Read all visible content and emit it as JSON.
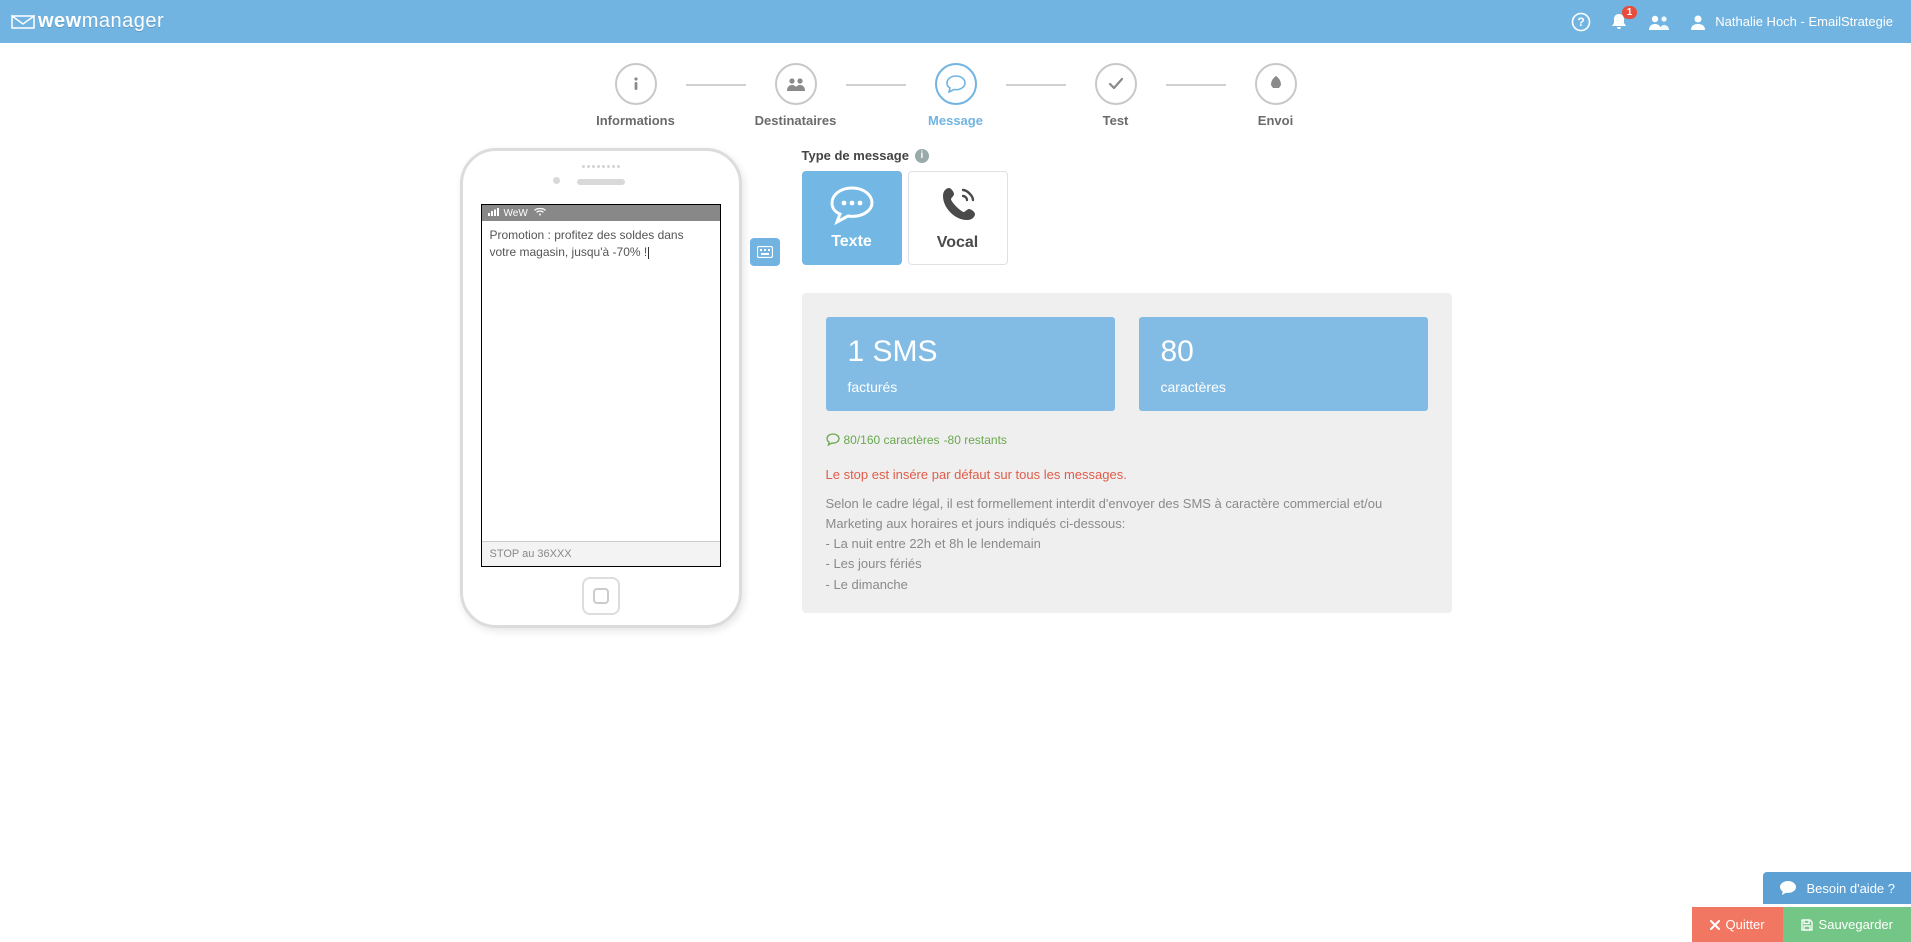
{
  "header": {
    "logo_text": "wewmanager",
    "notification_badge": "1",
    "user_name": "Nathalie Hoch - EmailStrategie"
  },
  "stepper": {
    "steps": [
      {
        "label": "Informations"
      },
      {
        "label": "Destinataires"
      },
      {
        "label": "Message"
      },
      {
        "label": "Test"
      },
      {
        "label": "Envoi"
      }
    ]
  },
  "phone": {
    "carrier": "WeW",
    "message_text": "Promotion : profitez des soldes dans votre magasin, jusqu'à -70% !",
    "stop_text": "STOP au 36XXX"
  },
  "panel": {
    "type_label": "Type de message",
    "type_texte": "Texte",
    "type_vocal": "Vocal",
    "stat_sms_value": "1 SMS",
    "stat_sms_label": "facturés",
    "stat_chars_value": "80",
    "stat_chars_label": "caractères",
    "char_counter_main": "80/160 caractères",
    "char_counter_remaining": "-80 restants",
    "warn_text": "Le stop est insére par défaut sur tous les messages.",
    "legal_intro": "Selon le cadre légal, il est formellement interdit d'envoyer des SMS à caractère commercial et/ou Marketing aux horaires et jours indiqués ci-dessous:",
    "legal_line1": "- La nuit entre 22h et 8h le lendemain",
    "legal_line2": "- Les jours fériés",
    "legal_line3": "- Le dimanche"
  },
  "help": {
    "label": "Besoin d'aide ?"
  },
  "footer": {
    "quit": "Quitter",
    "save": "Sauvegarder"
  }
}
